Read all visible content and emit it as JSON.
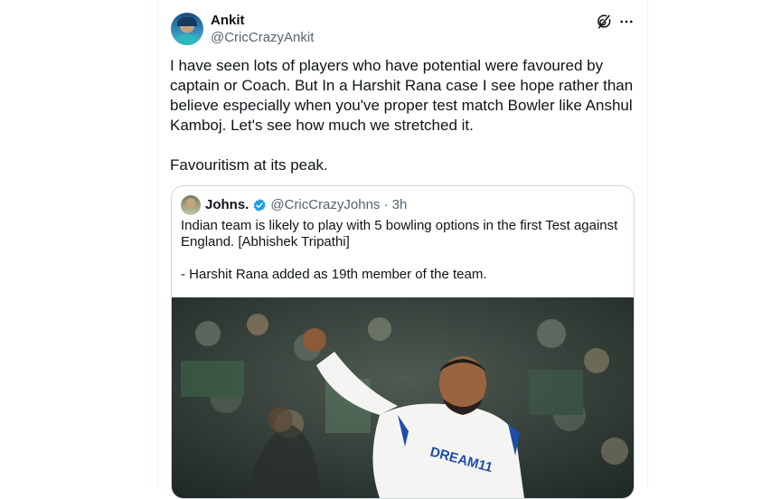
{
  "post": {
    "author_name": "Ankit",
    "author_handle": "@CricCrazyAnkit",
    "text": "I have seen lots of players who have potential were favoured by captain or Coach. But In a Harshit Rana case I see hope rather than believe especially when you've proper test match Bowler like Anshul Kamboj. Let's see how much we stretched it.\n\nFavouritism at its peak."
  },
  "quote": {
    "author_name": "Johns.",
    "author_handle": "@CricCrazyJohns",
    "time": "· 3h",
    "text": "Indian team is likely to play with 5 bowling options in the first Test against England. [Abhishek Tripathi]\n\n- Harshit Rana added as 19th member of the team.",
    "jersey_text": "DREAM11"
  },
  "colors": {
    "verified": "#1d9bf0",
    "secondary_text": "#536471",
    "border": "#cfd9de"
  },
  "icons": {
    "grok": "grok-icon",
    "more": "more-icon",
    "verified": "verified-badge-icon"
  }
}
